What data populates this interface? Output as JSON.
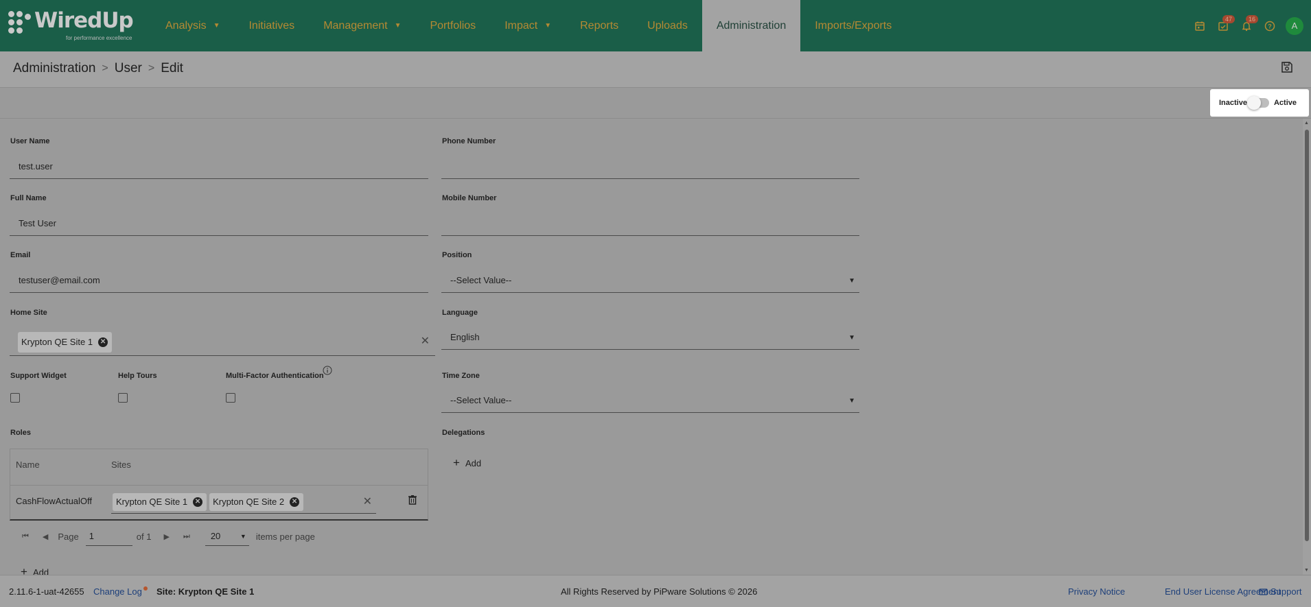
{
  "app": {
    "logo_text": "WiredUp",
    "logo_tagline": "for performance excellence"
  },
  "nav": {
    "items": [
      {
        "label": "Analysis",
        "has_caret": true
      },
      {
        "label": "Initiatives",
        "has_caret": false
      },
      {
        "label": "Management",
        "has_caret": true
      },
      {
        "label": "Portfolios",
        "has_caret": false
      },
      {
        "label": "Impact",
        "has_caret": true
      },
      {
        "label": "Reports",
        "has_caret": false
      },
      {
        "label": "Uploads",
        "has_caret": false
      },
      {
        "label": "Administration",
        "has_caret": false,
        "active": true
      },
      {
        "label": "Imports/Exports",
        "has_caret": false
      }
    ],
    "tasks_badge": "47",
    "notifications_badge": "16",
    "avatar_initial": "A"
  },
  "breadcrumb": [
    "Administration",
    "User",
    "Edit"
  ],
  "status": {
    "inactive_label": "Inactive",
    "active_label": "Active",
    "is_active": false
  },
  "form": {
    "user_name": {
      "label": "User Name",
      "value": "test.user"
    },
    "full_name": {
      "label": "Full Name",
      "value": "Test User"
    },
    "email": {
      "label": "Email",
      "value": "testuser@email.com"
    },
    "home_site": {
      "label": "Home Site",
      "chips": [
        "Krypton QE Site 1"
      ]
    },
    "phone_number": {
      "label": "Phone Number",
      "value": ""
    },
    "mobile_number": {
      "label": "Mobile Number",
      "value": ""
    },
    "position": {
      "label": "Position",
      "value": "--Select Value--"
    },
    "language": {
      "label": "Language",
      "value": "English"
    },
    "time_zone": {
      "label": "Time Zone",
      "value": "--Select Value--"
    },
    "support_widget": {
      "label": "Support Widget",
      "checked": false
    },
    "help_tours": {
      "label": "Help Tours",
      "checked": false
    },
    "mfa": {
      "label": "Multi-Factor Authentication",
      "checked": false
    },
    "roles_label": "Roles",
    "delegations_label": "Delegations",
    "add_label": "Add"
  },
  "roles_table": {
    "headers": [
      "Name",
      "Sites"
    ],
    "rows": [
      {
        "name": "CashFlowActualOff",
        "sites": [
          "Krypton QE Site 1",
          "Krypton QE Site 2"
        ]
      }
    ],
    "pager": {
      "page_label": "Page",
      "page": "1",
      "of_label": "of 1",
      "per_page": "20",
      "per_page_label": "items per page"
    }
  },
  "footer": {
    "version": "2.11.6-1-uat-42655",
    "change_log": "Change Log",
    "site": "Site: Krypton QE Site 1",
    "copyright": "All Rights Reserved by PiPware Solutions © 2026",
    "privacy": "Privacy Notice",
    "eula": "End User License Agreement",
    "support": "Support"
  },
  "colors": {
    "nav_bg": "#1a5e48",
    "nav_text": "#b58a33",
    "overlay_bg": "#9a9a9a",
    "link": "#1d3f7a"
  }
}
